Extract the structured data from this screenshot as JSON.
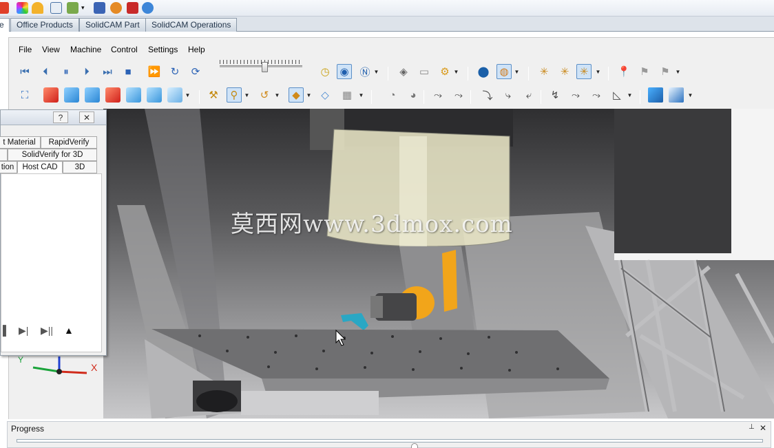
{
  "ribbon": {
    "tabs": [
      {
        "label": "e"
      },
      {
        "label": "Office Products"
      },
      {
        "label": "SolidCAM Part"
      },
      {
        "label": "SolidCAM Operations"
      }
    ]
  },
  "menu": {
    "items": [
      "File",
      "View",
      "Machine",
      "Control",
      "Settings",
      "Help"
    ]
  },
  "toolbar": {
    "playback": {
      "icons": [
        "rewind-to-start-icon",
        "step-back-icon",
        "pause-icon",
        "step-forward-icon",
        "fast-forward-to-end-icon",
        "stop-icon",
        "play-icon",
        "repeat-icon",
        "reset-icon"
      ],
      "speed_level": 0.55
    }
  },
  "panel": {
    "help_symbol": "?",
    "close_symbol": "✕",
    "tabs_row1": [
      "t Material",
      "RapidVerify"
    ],
    "tabs_row2": [
      "",
      "SolidVerify for 3D"
    ],
    "tabs_row3": [
      "tion",
      "Host CAD",
      "3D"
    ],
    "controls": [
      "▐",
      "▶|",
      "▶||",
      "▲"
    ]
  },
  "viewport": {
    "watermark": "莫西网www.3dmox.com",
    "axes": {
      "x": "X",
      "y": "Y"
    },
    "colors": {
      "tool_holder": "#f2a51a",
      "tool_tip": "#2aa7c4",
      "table": "#6f6f6f"
    }
  },
  "progress": {
    "title": "Progress",
    "pin_symbol": "📌",
    "close_symbol": "✕",
    "fraction": 0
  }
}
